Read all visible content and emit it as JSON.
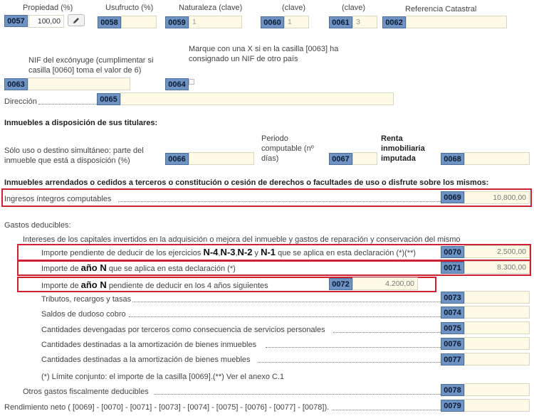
{
  "top": {
    "propiedad": {
      "label": "Propiedad (%)",
      "code": "0057",
      "value": "100,00"
    },
    "usufructo": {
      "label": "Usufructo (%)",
      "code": "0058",
      "value": ""
    },
    "naturaleza": {
      "label": "Naturaleza (clave)",
      "code": "0059",
      "value": "1"
    },
    "clave1": {
      "label": "(clave)",
      "code": "0060",
      "value": "1"
    },
    "clave2": {
      "label": "(clave)",
      "code": "0061",
      "value": "3"
    },
    "catastral": {
      "label": "Referencia Catastral",
      "code": "0062",
      "value": ""
    }
  },
  "nif": {
    "label": "NIF del excónyuge (cumplimentar si casilla [0060] toma el valor de 6)",
    "code": "0063",
    "value": ""
  },
  "marque": {
    "label": "Marque con una X si en la casilla [0063] ha consignado un NIF de otro país",
    "code": "0064"
  },
  "direccion": {
    "label": "Dirección",
    "code": "0065",
    "value": ""
  },
  "disposicion": {
    "title": "Inmuebles a disposición de sus titulares:",
    "uso_label": "Sólo uso o destino simultáneo: parte del inmueble que está a disposición (%)",
    "uso_code": "0066",
    "periodo_label": "Periodo computable (nº días)",
    "periodo_code": "0067",
    "renta_label": "Renta inmobiliaria imputada",
    "renta_code": "0068"
  },
  "arrendados": {
    "title": "Inmuebles arrendados o cedidos a terceros o constitución o cesión de derechos o facultades de uso o disfrute sobre los mismos:",
    "ingresos_label": "Ingresos íntegros computables",
    "ingresos_code": "0069",
    "ingresos_value": "10.800,00"
  },
  "gastos": {
    "title": "Gastos deducibles:",
    "intereses_title": "Intereses de los capitales invertidos en la adquisición o mejora del inmueble y gastos de reparación y conservación del mismo",
    "r70": {
      "pre": "Importe pendiente de deducir de los ejercicios ",
      "n4": "N-4",
      "n3": "N-3",
      "n2": "N-2",
      "y": " y ",
      "n1": "N-1",
      "post": " que se aplica en esta declaración (*)(**)",
      "code": "0070",
      "value": "2.500,00"
    },
    "r71": {
      "pre": "Importe de ",
      "big": "año N",
      "post": " que se aplica en esta declaración (*)",
      "code": "0071",
      "value": "8.300,00"
    },
    "r72": {
      "pre": "Importe de ",
      "big": "año N",
      "post": " pendiente de deducir en los 4 años siguientes",
      "code": "0072",
      "value": "4.200,00"
    },
    "r73": {
      "label": "Tributos, recargos y tasas",
      "code": "0073"
    },
    "r74": {
      "label": "Saldos de dudoso cobro",
      "code": "0074"
    },
    "r75": {
      "label": "Cantidades devengadas por terceros como consecuencia de servicios personales",
      "code": "0075"
    },
    "r76": {
      "label": "Cantidades destinadas a la amortización de bienes inmuebles",
      "code": "0076"
    },
    "r77": {
      "label": "Cantidades destinadas a la amortización de bienes muebles",
      "code": "0077"
    },
    "nota": "(*) Límite conjunto: el importe de la casilla [0069].(**) Ver el anexo C.1",
    "r78": {
      "label": "Otros gastos fiscalmente deducibles",
      "code": "0078"
    },
    "r79": {
      "label": "Rendimiento neto ( [0069] - [0070] - [0071] - [0073] - [0074] - [0075] - [0076] - [0077] - [0078]).",
      "code": "0079"
    }
  }
}
